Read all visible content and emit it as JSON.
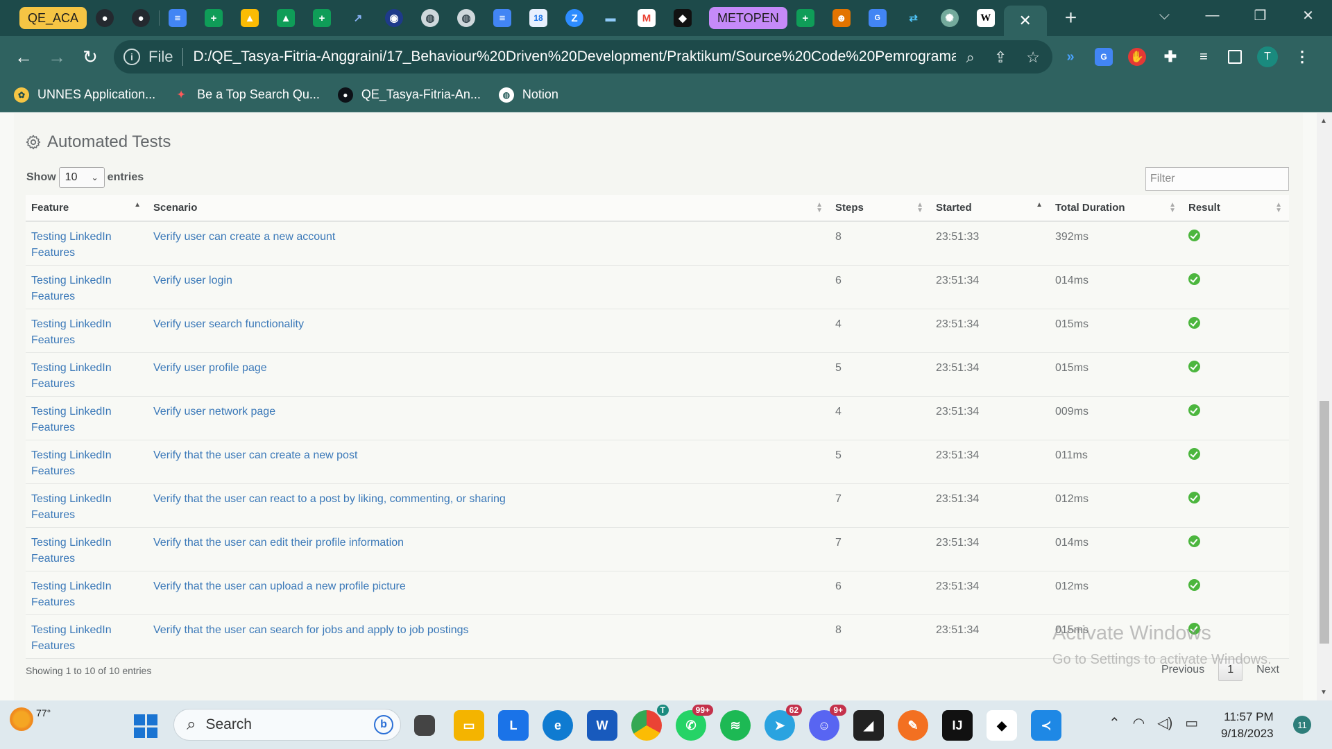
{
  "browser": {
    "tab_groups": [
      "QE_ACA",
      "METOPEN"
    ],
    "omnibox_prefix": "File",
    "url": "D:/QE_Tasya-Fitria-Anggraini/17_Behaviour%20Driven%20Development/Praktikum/Source%20Code%20Pemrograma...",
    "profile_initial": "T",
    "bookmarks": [
      {
        "label": "UNNES Application..."
      },
      {
        "label": "Be a Top Search Qu..."
      },
      {
        "label": "QE_Tasya-Fitria-An..."
      },
      {
        "label": "Notion"
      }
    ]
  },
  "page": {
    "title": "Automated Tests",
    "show_label": "Show",
    "entries_label": "entries",
    "entries_value": "10",
    "filter_placeholder": "Filter",
    "columns": [
      "Feature",
      "Scenario",
      "Steps",
      "Started",
      "Total Duration",
      "Result"
    ],
    "rows": [
      {
        "feature": "Testing LinkedIn Features",
        "scenario": "Verify user can create a new account",
        "steps": "8",
        "started": "23:51:33",
        "duration": "392ms",
        "result": "passed"
      },
      {
        "feature": "Testing LinkedIn Features",
        "scenario": "Verify user login",
        "steps": "6",
        "started": "23:51:34",
        "duration": "014ms",
        "result": "passed"
      },
      {
        "feature": "Testing LinkedIn Features",
        "scenario": "Verify user search functionality",
        "steps": "4",
        "started": "23:51:34",
        "duration": "015ms",
        "result": "passed"
      },
      {
        "feature": "Testing LinkedIn Features",
        "scenario": "Verify user profile page",
        "steps": "5",
        "started": "23:51:34",
        "duration": "015ms",
        "result": "passed"
      },
      {
        "feature": "Testing LinkedIn Features",
        "scenario": "Verify user network page",
        "steps": "4",
        "started": "23:51:34",
        "duration": "009ms",
        "result": "passed"
      },
      {
        "feature": "Testing LinkedIn Features",
        "scenario": "Verify that the user can create a new post",
        "steps": "5",
        "started": "23:51:34",
        "duration": "011ms",
        "result": "passed"
      },
      {
        "feature": "Testing LinkedIn Features",
        "scenario": "Verify that the user can react to a post by liking, commenting, or sharing",
        "steps": "7",
        "started": "23:51:34",
        "duration": "012ms",
        "result": "passed"
      },
      {
        "feature": "Testing LinkedIn Features",
        "scenario": "Verify that the user can edit their profile information",
        "steps": "7",
        "started": "23:51:34",
        "duration": "014ms",
        "result": "passed"
      },
      {
        "feature": "Testing LinkedIn Features",
        "scenario": "Verify that the user can upload a new profile picture",
        "steps": "6",
        "started": "23:51:34",
        "duration": "012ms",
        "result": "passed"
      },
      {
        "feature": "Testing LinkedIn Features",
        "scenario": "Verify that the user can search for jobs and apply to job postings",
        "steps": "8",
        "started": "23:51:34",
        "duration": "015ms",
        "result": "passed"
      }
    ],
    "info": "Showing 1 to 10 of 10 entries",
    "pagination": {
      "previous": "Previous",
      "current": "1",
      "next": "Next"
    },
    "watermark": {
      "line1": "Activate Windows",
      "line2": "Go to Settings to activate Windows."
    }
  },
  "taskbar": {
    "weather_temp": "77°",
    "search_label": "Search",
    "badges": {
      "chrome": "T",
      "whatsapp": "99+",
      "telegram": "62",
      "discord": "9+"
    },
    "time": "11:57 PM",
    "date": "9/18/2023",
    "notifications": "11"
  },
  "colors": {
    "link": "#3a78b8",
    "success": "#4cb63e",
    "chrome_frame": "#1d4a4a",
    "chrome_toolbar": "#2f6260"
  }
}
